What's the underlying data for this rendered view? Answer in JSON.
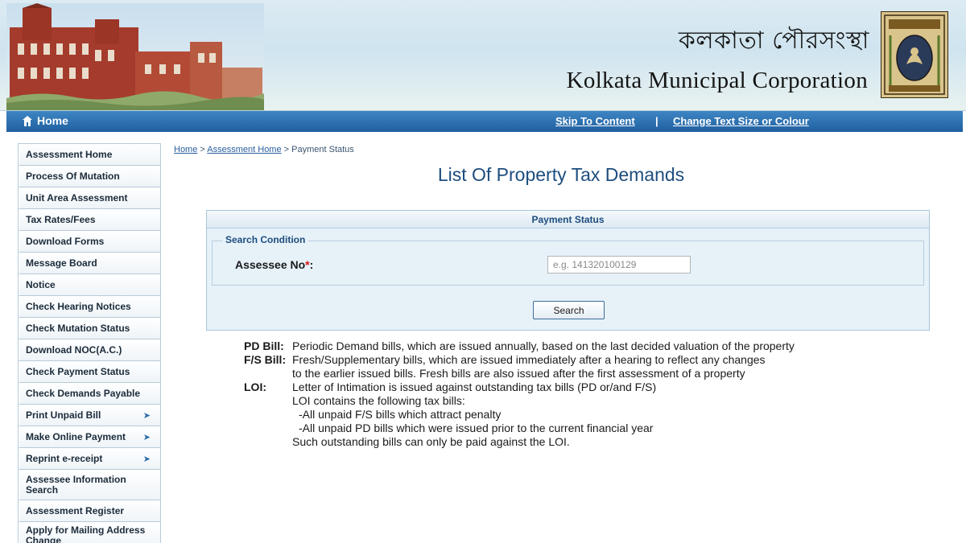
{
  "header": {
    "title_bengali": "কলকাতা পৌরসংস্থা",
    "title_english": "Kolkata Municipal Corporation"
  },
  "navbar": {
    "home_label": "Home",
    "skip_label": "Skip To Content",
    "separator": "|",
    "change_text_label": "Change Text Size or Colour"
  },
  "sidebar": {
    "items": [
      {
        "label": "Assessment Home"
      },
      {
        "label": "Process Of Mutation"
      },
      {
        "label": "Unit Area Assessment"
      },
      {
        "label": "Tax Rates/Fees"
      },
      {
        "label": "Download Forms"
      },
      {
        "label": "Message Board"
      },
      {
        "label": "Notice"
      },
      {
        "label": "Check Hearing Notices"
      },
      {
        "label": "Check Mutation Status"
      },
      {
        "label": "Download NOC(A.C.)"
      },
      {
        "label": "Check Payment Status"
      },
      {
        "label": "Check Demands Payable"
      },
      {
        "label": "Print Unpaid Bill",
        "arrow": "➤"
      },
      {
        "label": "Make Online Payment",
        "arrow": "➤"
      },
      {
        "label": "Reprint e-receipt",
        "arrow": "➤"
      },
      {
        "label": "Assessee Information Search"
      },
      {
        "label": "Assessment Register"
      },
      {
        "label": "Apply for Mailing Address Change"
      }
    ]
  },
  "breadcrumb": {
    "home": "Home",
    "sep1": " > ",
    "assessment_home": "Assessment Home",
    "sep2": " > ",
    "current": "Payment Status"
  },
  "page_title": "List Of Property Tax Demands",
  "panel": {
    "title": "Payment Status",
    "legend": "Search Condition",
    "field_label": "Assessee No",
    "required_mark": "*",
    "field_colon": ":",
    "input_value": "",
    "input_placeholder": "e.g. 141320100129",
    "search_button": "Search"
  },
  "info": {
    "pd_key": "PD Bill:",
    "pd_text": "Periodic Demand bills, which are issued annually, based on the last decided valuation of the property",
    "fs_key": "F/S Bill:",
    "fs_line1": "Fresh/Supplementary bills, which are issued immediately after a hearing to reflect any changes",
    "fs_line2": "to the earlier issued bills. Fresh bills are also issued after the first assessment of a property",
    "loi_key": "LOI:",
    "loi_line1": "Letter of Intimation is issued against outstanding tax bills (PD or/and F/S)",
    "loi_line2": "LOI contains the following tax bills:",
    "loi_line3": "-All unpaid F/S bills which attract penalty",
    "loi_line4": "-All unpaid PD bills which were issued prior to the current financial year",
    "loi_line5": "Such outstanding bills can only be paid against the LOI."
  },
  "colors": {
    "navbar": "#2b6fb0",
    "title": "#1d4d7f",
    "panel_bg": "#e6f1f8"
  }
}
